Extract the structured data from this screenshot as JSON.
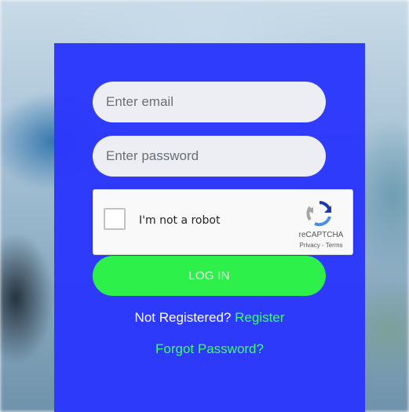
{
  "login_form": {
    "email": {
      "placeholder": "Enter email",
      "value": ""
    },
    "password": {
      "placeholder": "Enter password",
      "value": ""
    },
    "recaptcha": {
      "label": "I'm not a robot",
      "brand": "reCAPTCHA",
      "privacy_link": "Privacy",
      "separator": " - ",
      "terms_link": "Terms",
      "checked": false
    },
    "login_button_label": "LOG IN",
    "register_prompt": "Not Registered? ",
    "register_link": "Register",
    "forgot_password_link": "Forgot Password?"
  },
  "colors": {
    "card_background": "#2b37fc",
    "button_green": "#2ef04a",
    "link_green": "#3dff60",
    "field_background": "#eceef4"
  },
  "icons": {
    "recaptcha_logo": "recaptcha-arrows-icon"
  }
}
